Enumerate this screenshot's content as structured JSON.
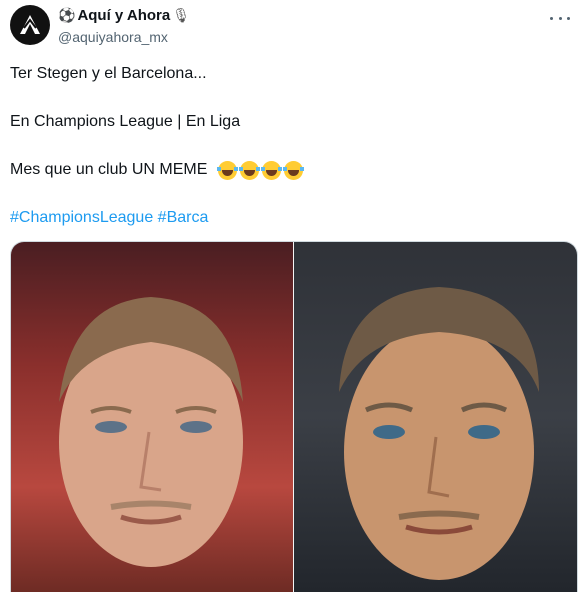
{
  "tweet": {
    "display_name": "Aquí y Ahora",
    "name_prefix_icon": "⚽",
    "name_suffix_icon": "🎙",
    "handle": "@aquiyahora_mx",
    "avatar_icon": "logo-icon",
    "line1": "Ter Stegen y el Barcelona...",
    "line2": "En Champions League | En Liga",
    "line3": "Mes que un club UN MEME",
    "laugh_emoji_count": 4,
    "hashtags": "#ChampionsLeague #Barca"
  },
  "media": {
    "left_photo": "player-photo-champions",
    "right_photo": "player-photo-liga"
  },
  "colors": {
    "link": "#1d9bf0",
    "secondary_text": "#536471",
    "primary_text": "#0f1419"
  }
}
